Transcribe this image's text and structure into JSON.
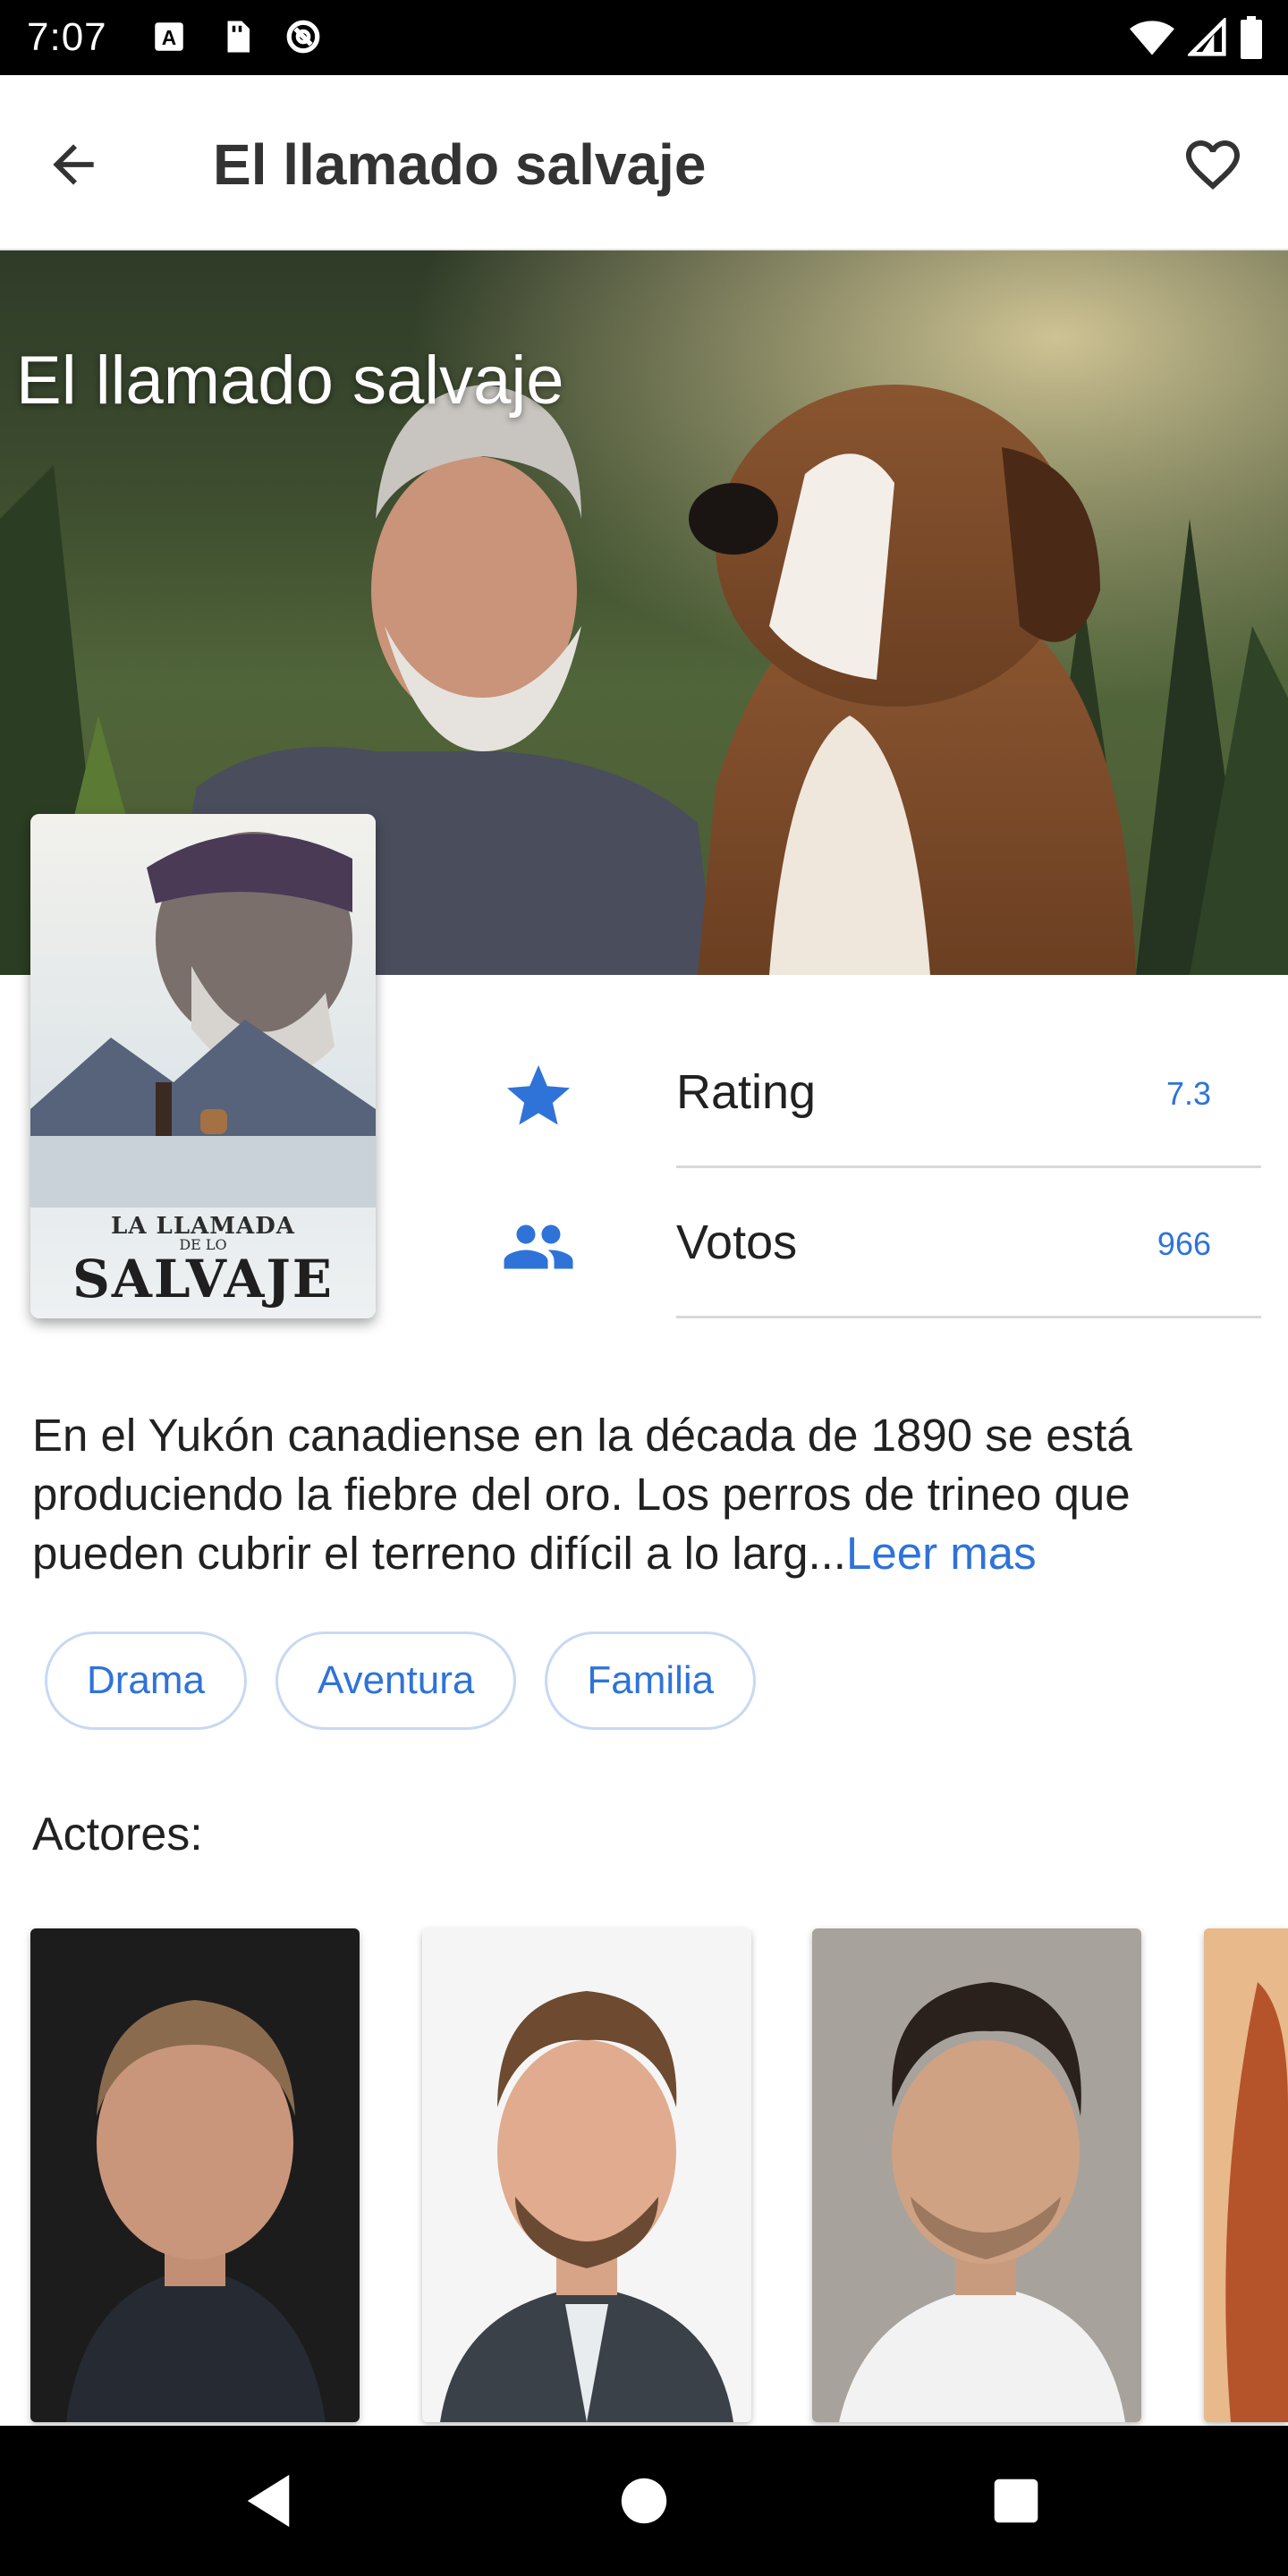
{
  "status_bar": {
    "time": "7:07",
    "left_icons": [
      "a-box-icon",
      "sim-card-icon",
      "no-disturb-icon"
    ],
    "right_icons": [
      "wifi-icon",
      "signal-icon",
      "battery-icon"
    ]
  },
  "app_bar": {
    "title": "El llamado salvaje",
    "back_icon": "arrow-back-icon",
    "favorite_icon": "heart-outline-icon"
  },
  "hero": {
    "title": "El llamado salvaje"
  },
  "poster": {
    "line1": "LA LLAMADA",
    "line2": "DE LO",
    "line3": "SALVAJE"
  },
  "stats": [
    {
      "icon": "star-icon",
      "label": "Rating",
      "value": "7.3"
    },
    {
      "icon": "people-icon",
      "label": "Votos",
      "value": "966"
    }
  ],
  "description": {
    "text": "En el Yukón canadiense en la década de 1890 se está produciendo la fiebre del oro. Los perros de trineo que pueden cubrir el terreno difícil a lo larg...",
    "read_more": "Leer mas"
  },
  "genres": [
    "Drama",
    "Aventura",
    "Familia"
  ],
  "actors_label": "Actores:",
  "colors": {
    "accent": "#2f73d8",
    "chip_border": "#c7d9f3",
    "status_bar": "#000000",
    "nav_bar": "#000000"
  },
  "nav_bar": {
    "icons": [
      "back-triangle-icon",
      "home-circle-icon",
      "recents-square-icon"
    ]
  }
}
